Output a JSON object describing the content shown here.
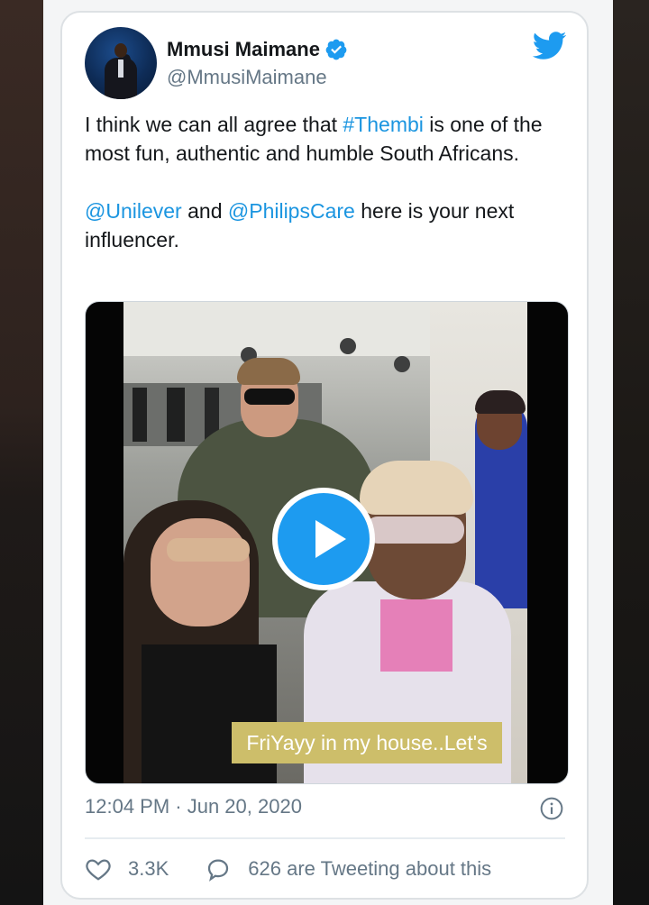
{
  "user": {
    "name": "Mmusi Maimane",
    "handle": "@MmusiMaimane"
  },
  "tweet": {
    "line1_pre": "I think we can all agree that ",
    "hashtag": "#Thembi",
    "line1_post": " is one of the most fun, authentic and humble South Africans.",
    "mention1": "@Unilever",
    "and_text": " and ",
    "mention2": "@PhilipsCare",
    "line2_post": " here is your next influencer."
  },
  "media": {
    "caption": "FriYayy in my house..Let's"
  },
  "meta": {
    "timestamp": "12:04 PM · Jun 20, 2020"
  },
  "actions": {
    "likes": "3.3K",
    "tweeting": "626 are Tweeting about this"
  },
  "colors": {
    "accent": "#1b95e0",
    "text": "#14171a",
    "muted": "#657786"
  },
  "icons": [
    "verified-badge-icon",
    "twitter-bird-icon",
    "play-icon",
    "info-icon",
    "heart-icon",
    "speech-bubble-icon"
  ]
}
